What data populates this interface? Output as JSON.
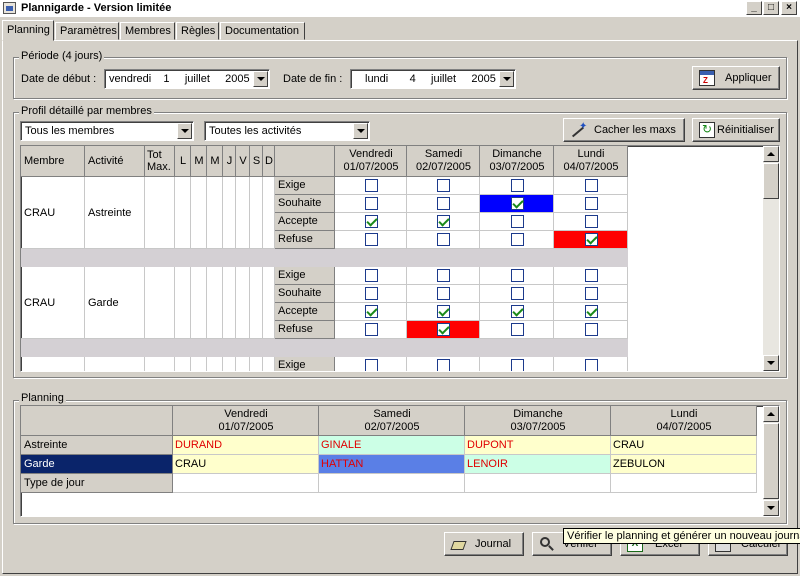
{
  "window": {
    "title": "Plannigarde - Version limitée",
    "min": "_",
    "max": "□",
    "close": "×"
  },
  "tabs": [
    "Planning",
    "Paramètres",
    "Membres",
    "Règles",
    "Documentation"
  ],
  "periode": {
    "label": "Période (4 jours)",
    "debut_label": "Date de début :",
    "debut_value": "vendredi    1     juillet     2005",
    "fin_label": "Date de fin :",
    "fin_value": "lundi       4     juillet     2005",
    "appliquer": "Appliquer"
  },
  "profil": {
    "label": "Profil détaillé par membres",
    "membres_filter": "Tous les membres",
    "activites_filter": "Toutes les activités",
    "cacher": "Cacher les maxs",
    "reinit": "Réinitialiser",
    "headers": {
      "membre": "Membre",
      "activite": "Activité",
      "tot": "Tot",
      "max": "Max.",
      "days": [
        "L",
        "M",
        "M",
        "J",
        "V",
        "S",
        "D"
      ]
    },
    "dates": [
      {
        "day": "Vendredi",
        "date": "01/07/2005"
      },
      {
        "day": "Samedi",
        "date": "02/07/2005"
      },
      {
        "day": "Dimanche",
        "date": "03/07/2005"
      },
      {
        "day": "Lundi",
        "date": "04/07/2005"
      }
    ],
    "row_types": [
      "Exige",
      "Souhaite",
      "Accepte",
      "Refuse"
    ],
    "groups": [
      {
        "membre": "CRAU",
        "activite": "Astreinte",
        "checks": [
          [
            false,
            false,
            false,
            false
          ],
          [
            false,
            false,
            true,
            false
          ],
          [
            true,
            true,
            false,
            false
          ],
          [
            false,
            false,
            false,
            true
          ]
        ],
        "highlights": [
          [
            null,
            null,
            null,
            null
          ],
          [
            null,
            null,
            "#0000ff",
            null
          ],
          [
            null,
            null,
            null,
            null
          ],
          [
            null,
            null,
            null,
            "#ff0000"
          ]
        ]
      },
      {
        "membre": "CRAU",
        "activite": "Garde",
        "checks": [
          [
            false,
            false,
            false,
            false
          ],
          [
            false,
            false,
            false,
            false
          ],
          [
            true,
            true,
            true,
            true
          ],
          [
            false,
            true,
            false,
            false
          ]
        ],
        "highlights": [
          [
            null,
            null,
            null,
            null
          ],
          [
            null,
            null,
            null,
            null
          ],
          [
            null,
            null,
            null,
            null
          ],
          [
            null,
            "#ff0000",
            null,
            null
          ]
        ]
      },
      {
        "membre": "",
        "activite": "",
        "checks": [
          [
            false,
            false,
            false,
            false
          ]
        ],
        "highlights": [
          [
            null,
            null,
            null,
            null
          ]
        ]
      }
    ]
  },
  "planning": {
    "label": "Planning",
    "dates": [
      {
        "day": "Vendredi",
        "date": "01/07/2005"
      },
      {
        "day": "Samedi",
        "date": "02/07/2005"
      },
      {
        "day": "Dimanche",
        "date": "03/07/2005"
      },
      {
        "day": "Lundi",
        "date": "04/07/2005"
      }
    ],
    "rows": [
      {
        "label": "Astreinte",
        "selected": false,
        "cells": [
          {
            "text": "DURAND",
            "bg": "#ffffcc",
            "color": "#e00000"
          },
          {
            "text": "GINALE",
            "bg": "#ccffe6",
            "color": "#e00000"
          },
          {
            "text": "DUPONT",
            "bg": "#ffffcc",
            "color": "#e00000"
          },
          {
            "text": "CRAU",
            "bg": "#ffffcc",
            "color": "#000000"
          }
        ]
      },
      {
        "label": "Garde",
        "selected": true,
        "cells": [
          {
            "text": "CRAU",
            "bg": "#ffffcc",
            "color": "#000000"
          },
          {
            "text": "HATTAN",
            "bg": "#5a7fe6",
            "color": "#e00000"
          },
          {
            "text": "LENOIR",
            "bg": "#ccffe6",
            "color": "#e00000"
          },
          {
            "text": "ZEBULON",
            "bg": "#ffffcc",
            "color": "#000000"
          }
        ]
      },
      {
        "label": "Type de jour",
        "selected": false,
        "cells": [
          {
            "text": "",
            "bg": "#ffffff",
            "color": "#000000"
          },
          {
            "text": "",
            "bg": "#ffffff",
            "color": "#000000"
          },
          {
            "text": "",
            "bg": "#ffffff",
            "color": "#000000"
          },
          {
            "text": "",
            "bg": "#ffffff",
            "color": "#000000"
          }
        ]
      }
    ]
  },
  "footer": {
    "journal": "Journal",
    "verifier": "Vérifier",
    "excel": "Excel",
    "calculer": "Calculer"
  },
  "tooltip": "Vérifier le planning et générer un nouveau journal",
  "colors": {
    "selected_row": "#0a246a",
    "group_separator": "#d4d0d4"
  }
}
